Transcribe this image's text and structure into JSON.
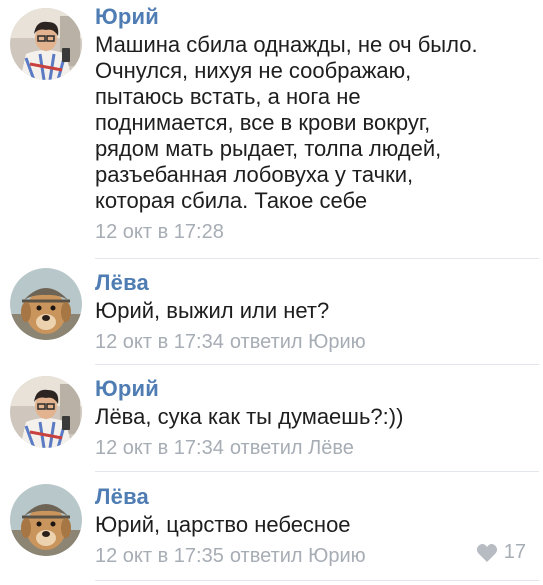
{
  "comments": [
    {
      "author": "Юрий",
      "text": "Машина сбила однажды, не оч было.\nОчнулся, нихуя не соображаю,\nпытаюсь встать, а нога не\nподнимается, все в крови вокруг,\nрядом мать рыдает, толпа людей,\nразъебанная лобовуха у тачки,\nкоторая сбила. Такое себе",
      "time": "12 окт в 17:28",
      "reply_to": "",
      "avatar_icon": "user-photo-avatar"
    },
    {
      "author": "Лёва",
      "text": "Юрий, выжил или нет?",
      "time": "12 окт в 17:34",
      "reply_to": "ответил Юрию",
      "avatar_icon": "dog-photo-avatar"
    },
    {
      "author": "Юрий",
      "text": "Лёва, сука как ты думаешь?:))",
      "time": "12 окт в 17:34",
      "reply_to": "ответил Лёве",
      "avatar_icon": "user-photo-avatar"
    },
    {
      "author": "Лёва",
      "text": "Юрий, царство небесное",
      "time": "12 окт в 17:35",
      "reply_to": "ответил Юрию",
      "avatar_icon": "dog-photo-avatar",
      "likes": "17",
      "like_icon": "heart-icon"
    }
  ],
  "colors": {
    "author": "#4f7db3",
    "meta": "#a7adb5",
    "text": "#1e1e1e",
    "divider": "#e3e6ea"
  }
}
